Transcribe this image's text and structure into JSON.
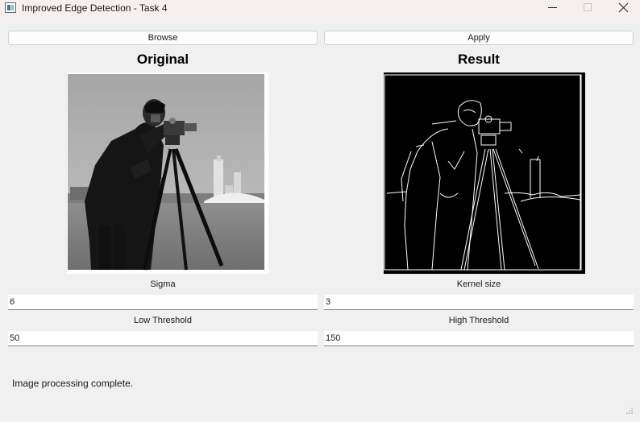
{
  "window": {
    "title": "Improved Edge Detection - Task 4",
    "controls": [
      "minimize-icon",
      "maximize-icon",
      "close-icon"
    ]
  },
  "toolbar": {
    "browse_label": "Browse",
    "apply_label": "Apply"
  },
  "panes": {
    "original_title": "Original",
    "result_title": "Result"
  },
  "params": {
    "sigma_label": "Sigma",
    "sigma_value": "6",
    "kernel_label": "Kernel size",
    "kernel_value": "3",
    "low_label": "Low Threshold",
    "low_value": "50",
    "high_label": "High Threshold",
    "high_value": "150"
  },
  "status": {
    "message": "Image processing complete."
  },
  "colors": {
    "window_bg": "#f0f0f0",
    "titlebar_bg": "#f7efef",
    "result_bg": "#000000",
    "input_underline": "#868686"
  }
}
